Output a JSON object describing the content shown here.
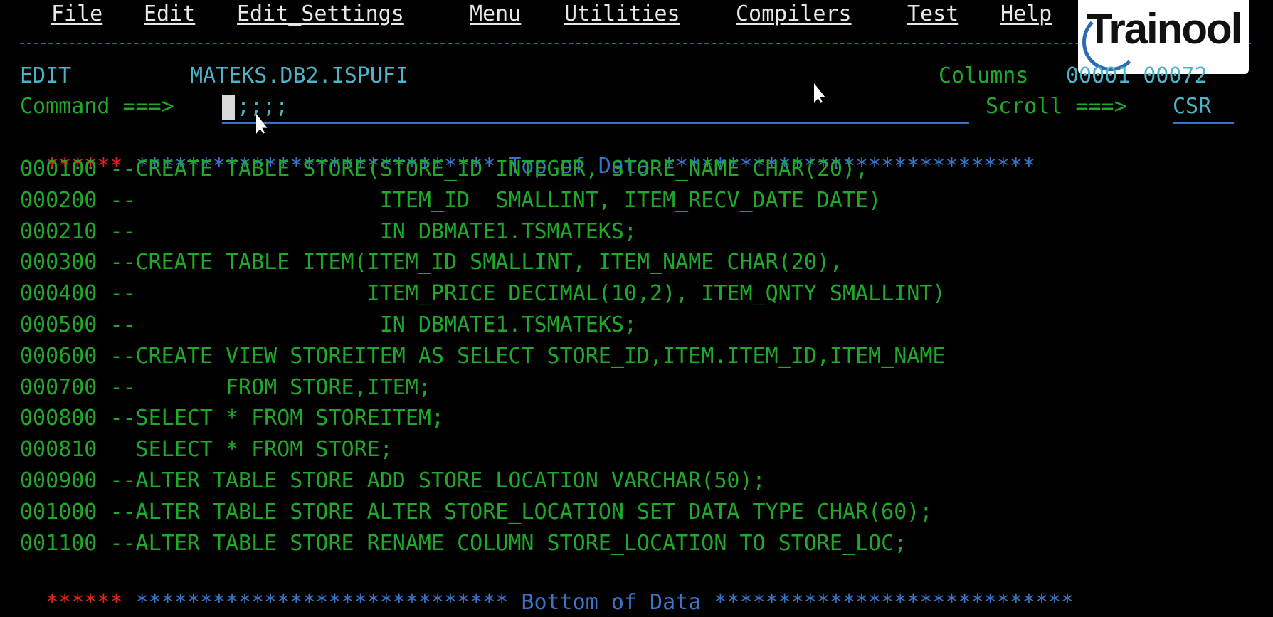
{
  "menubar": {
    "items": [
      "File",
      "Edit",
      "Edit_Settings",
      "Menu",
      "Utilities",
      "Compilers",
      "Test",
      "Help"
    ]
  },
  "header": {
    "mode": "EDIT",
    "dataset": "MATEKS.DB2.ISPUFI",
    "columns_label": "Columns",
    "columns_range": "00001 00072"
  },
  "command": {
    "label": "Command ===>",
    "value": ";;;;",
    "scroll_label": "Scroll ===>",
    "scroll_value": "CSR"
  },
  "logo": {
    "text": "Trainool"
  },
  "markers": {
    "red_stars": "******",
    "top_stars_left": "****************************",
    "top_text": "Top of Data",
    "top_stars_right": "*****************************",
    "bottom_stars_left": "*****************************",
    "bottom_text": "Bottom of Data",
    "bottom_stars_right": "****************************"
  },
  "source_lines": [
    {
      "num": "000100",
      "text": "--CREATE TABLE STORE(STORE_ID INTEGER, STORE_NAME CHAR(20),"
    },
    {
      "num": "000200",
      "text": "--                   ITEM_ID  SMALLINT, ITEM_RECV_DATE DATE)"
    },
    {
      "num": "000210",
      "text": "--                   IN DBMATE1.TSMATEKS;"
    },
    {
      "num": "000300",
      "text": "--CREATE TABLE ITEM(ITEM_ID SMALLINT, ITEM_NAME CHAR(20),"
    },
    {
      "num": "000400",
      "text": "--                  ITEM_PRICE DECIMAL(10,2), ITEM_QNTY SMALLINT)"
    },
    {
      "num": "000500",
      "text": "--                   IN DBMATE1.TSMATEKS;"
    },
    {
      "num": "000600",
      "text": "--CREATE VIEW STOREITEM AS SELECT STORE_ID,ITEM.ITEM_ID,ITEM_NAME"
    },
    {
      "num": "000700",
      "text": "--       FROM STORE,ITEM;"
    },
    {
      "num": "000800",
      "text": "--SELECT * FROM STOREITEM;"
    },
    {
      "num": "000810",
      "text": "  SELECT * FROM STORE;"
    },
    {
      "num": "000900",
      "text": "--ALTER TABLE STORE ADD STORE_LOCATION VARCHAR(50);"
    },
    {
      "num": "001000",
      "text": "--ALTER TABLE STORE ALTER STORE_LOCATION SET DATA TYPE CHAR(60);"
    },
    {
      "num": "001100",
      "text": "--ALTER TABLE STORE RENAME COLUMN STORE_LOCATION TO STORE_LOC;"
    }
  ]
}
